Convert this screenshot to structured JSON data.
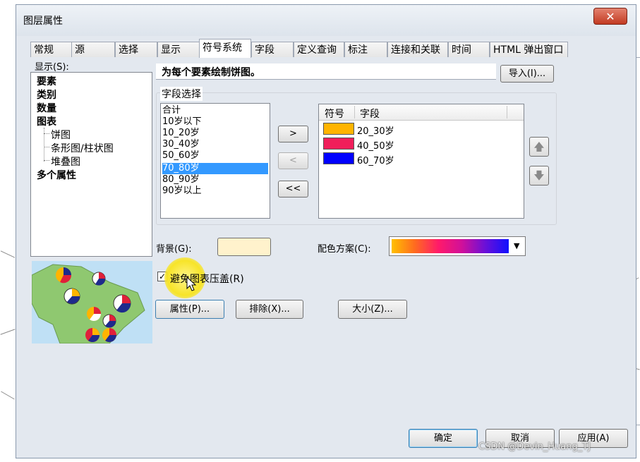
{
  "window": {
    "title": "图层属性",
    "close_glyph": "✕"
  },
  "tabs": [
    "常规",
    "源",
    "选择",
    "显示",
    "符号系统",
    "字段",
    "定义查询",
    "标注",
    "连接和关联",
    "时间",
    "HTML 弹出窗口"
  ],
  "show_panel": {
    "label": "显示(S):",
    "items": [
      {
        "label": "要素",
        "bold": true
      },
      {
        "label": "类别",
        "bold": true
      },
      {
        "label": "数量",
        "bold": true
      },
      {
        "label": "图表",
        "bold": true
      },
      {
        "label": "饼图",
        "bold": false
      },
      {
        "label": "条形图/柱状图",
        "bold": false
      },
      {
        "label": "堆叠图",
        "bold": false
      },
      {
        "label": "多个属性",
        "bold": true
      }
    ]
  },
  "description": "为每个要素绘制饼图。",
  "import_button": "导入(I)...",
  "field_selection": {
    "legend": "字段选择",
    "available": [
      "合计",
      "10岁以下",
      "10_20岁",
      "30_40岁",
      "50_60岁",
      "70_80岁",
      "80_90岁",
      "90岁以上"
    ],
    "selected_available": "70_80岁",
    "add_button": ">",
    "remove_button": "<",
    "remove_all_button": "<<",
    "symbol_header": "符号",
    "field_header": "字段",
    "chosen": [
      {
        "field": "20_30岁",
        "color": "#ffb400"
      },
      {
        "field": "40_50岁",
        "color": "#f01e5a"
      },
      {
        "field": "60_70岁",
        "color": "#0000ff"
      }
    ],
    "up_glyph": "🡅",
    "down_glyph": "🡇"
  },
  "background": {
    "label": "背景(G):",
    "color": "#fff2cc"
  },
  "color_scheme": {
    "label": "配色方案(C):",
    "dropdown_glyph": "▼"
  },
  "prevent_overlap": {
    "label": "避免图表压盖(R)",
    "checked": true,
    "check_glyph": "✓"
  },
  "buttons": {
    "properties": "属性(P)...",
    "exclude": "排除(X)...",
    "size": "大小(Z)..."
  },
  "footer": {
    "ok": "确定",
    "cancel": "取消",
    "apply": "应用(A)"
  },
  "watermark": "CSDN @Devin_Huang_TJ"
}
